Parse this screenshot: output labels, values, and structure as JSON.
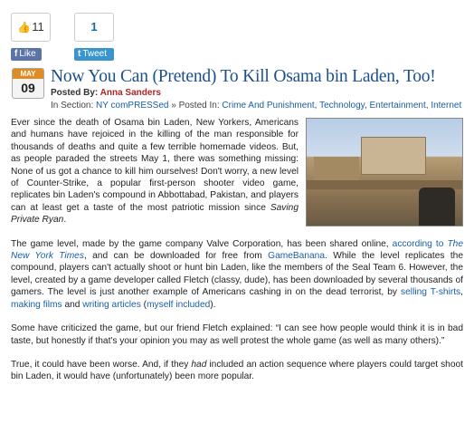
{
  "share": {
    "facebook": {
      "count": "11",
      "button_label": "Like"
    },
    "twitter": {
      "count": "1",
      "button_label": "Tweet"
    }
  },
  "post": {
    "date": {
      "month": "MAY",
      "day": "09"
    },
    "title": "Now You Can (Pretend) To Kill Osama bin Laden, Too!",
    "byline_label": "Posted By:",
    "author": "Anna Sanders",
    "in_section_label": "In Section:",
    "section": "NY comPRESSed",
    "separator": "»",
    "posted_in_label": "Posted In:",
    "categories": [
      "Crime And Punishment",
      "Technology",
      "Entertainment",
      "Internet"
    ],
    "image_alt": "Counter-Strike level screenshot"
  },
  "article": {
    "p1": "Ever since the death of Osama bin Laden, New Yorkers, Americans and humans have rejoiced in the killing of the man responsible for thousands of deaths and quite a few terrible homemade videos. But, as people paraded the streets May 1, there was something missing: None of us got a chance to kill him ourselves! Don't worry, a new level of Counter-Strike, a popular first-person shooter video game, replicates bin Laden's compound in Abbottabad, Pakistan, and players can at least get a taste of the most patriotic mission since ",
    "p1_italic": "Saving Private Ryan",
    "p1_end": ".",
    "p2_a": "The game level, made by the game company Valve Corporation, has been shared online, ",
    "p2_link1": "according to ",
    "p2_link1_italic": "The New York Times",
    "p2_b": ", and can be downloaded for free from ",
    "p2_link2": "GameBanana",
    "p2_c": ". While the level replicates the compound, players can't actually shoot or hunt bin Laden, like the members of the Seal Team 6. However, the level, created by a game developer called Fletch (classy, dude), has been downloaded by several thousands of gamers. The level is just another example of Americans cashing in on the dead terrorist, by ",
    "p2_link3": "selling T-shirts",
    "p2_d": ", ",
    "p2_link4": "making films",
    "p2_e": " and ",
    "p2_link5": "writing articles",
    "p2_f": " (",
    "p2_link6": "myself included",
    "p2_g": ").",
    "p3": "Some have criticized the game, but our friend Fletch explained: “I can see how people would think it is in bad taste, but honestly if that's your opinion you may as well protest the whole game (as well as many others).”",
    "p4_a": "True, it could have been worse. And, if they ",
    "p4_italic": "had",
    "p4_b": " included an action sequence where players could target shoot bin Laden, it would have (unfortunately) been more popular."
  },
  "colors": {
    "title": "#1c4f8c",
    "author": "#b22222",
    "link": "#1a5da6",
    "date_accent": "#e08a22"
  }
}
